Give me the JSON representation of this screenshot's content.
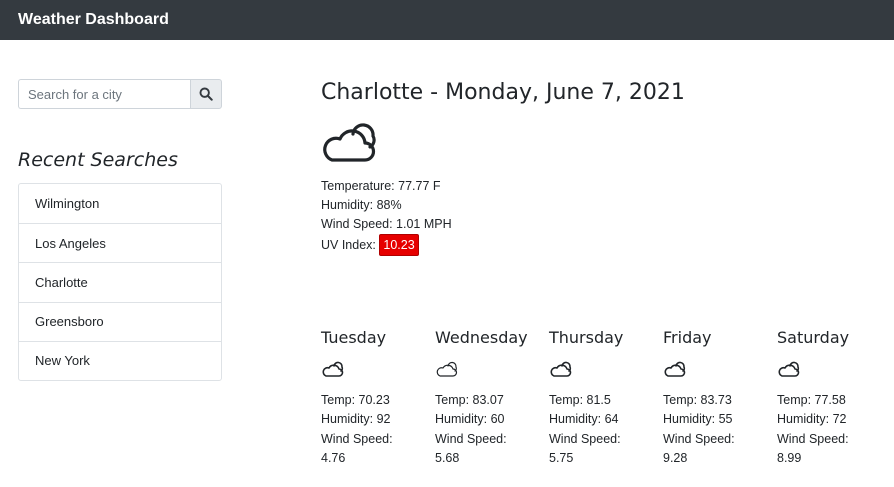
{
  "navbar": {
    "title": "Weather Dashboard"
  },
  "search": {
    "placeholder": "Search for a city",
    "icon": "search-icon"
  },
  "recent": {
    "title": "Recent Searches",
    "items": [
      "Wilmington",
      "Los Angeles",
      "Charlotte",
      "Greensboro",
      "New York"
    ]
  },
  "current": {
    "heading": "Charlotte - Monday, June 7, 2021",
    "icon": "cloud-icon",
    "temperature": "Temperature: 77.77 F",
    "humidity": "Humidity: 88%",
    "wind": "Wind Speed: 1.01 MPH",
    "uv_label": "UV Index:",
    "uv_value": "10.23",
    "uv_color": "#e60000"
  },
  "forecast": [
    {
      "day": "Tuesday",
      "temp": "Temp: 70.23",
      "humidity": "Humidity: 92",
      "wind_label": "Wind Speed:",
      "wind_value": "4.76"
    },
    {
      "day": "Wednesday",
      "temp": "Temp: 83.07",
      "humidity": "Humidity: 60",
      "wind_label": "Wind Speed:",
      "wind_value": "5.68"
    },
    {
      "day": "Thursday",
      "temp": "Temp: 81.5",
      "humidity": "Humidity: 64",
      "wind_label": "Wind Speed:",
      "wind_value": "5.75"
    },
    {
      "day": "Friday",
      "temp": "Temp: 83.73",
      "humidity": "Humidity: 55",
      "wind_label": "Wind Speed:",
      "wind_value": "9.28"
    },
    {
      "day": "Saturday",
      "temp": "Temp: 77.58",
      "humidity": "Humidity: 72",
      "wind_label": "Wind Speed:",
      "wind_value": "8.99"
    }
  ],
  "colors": {
    "navbar": "#343a40",
    "uv_high": "#e60000"
  }
}
